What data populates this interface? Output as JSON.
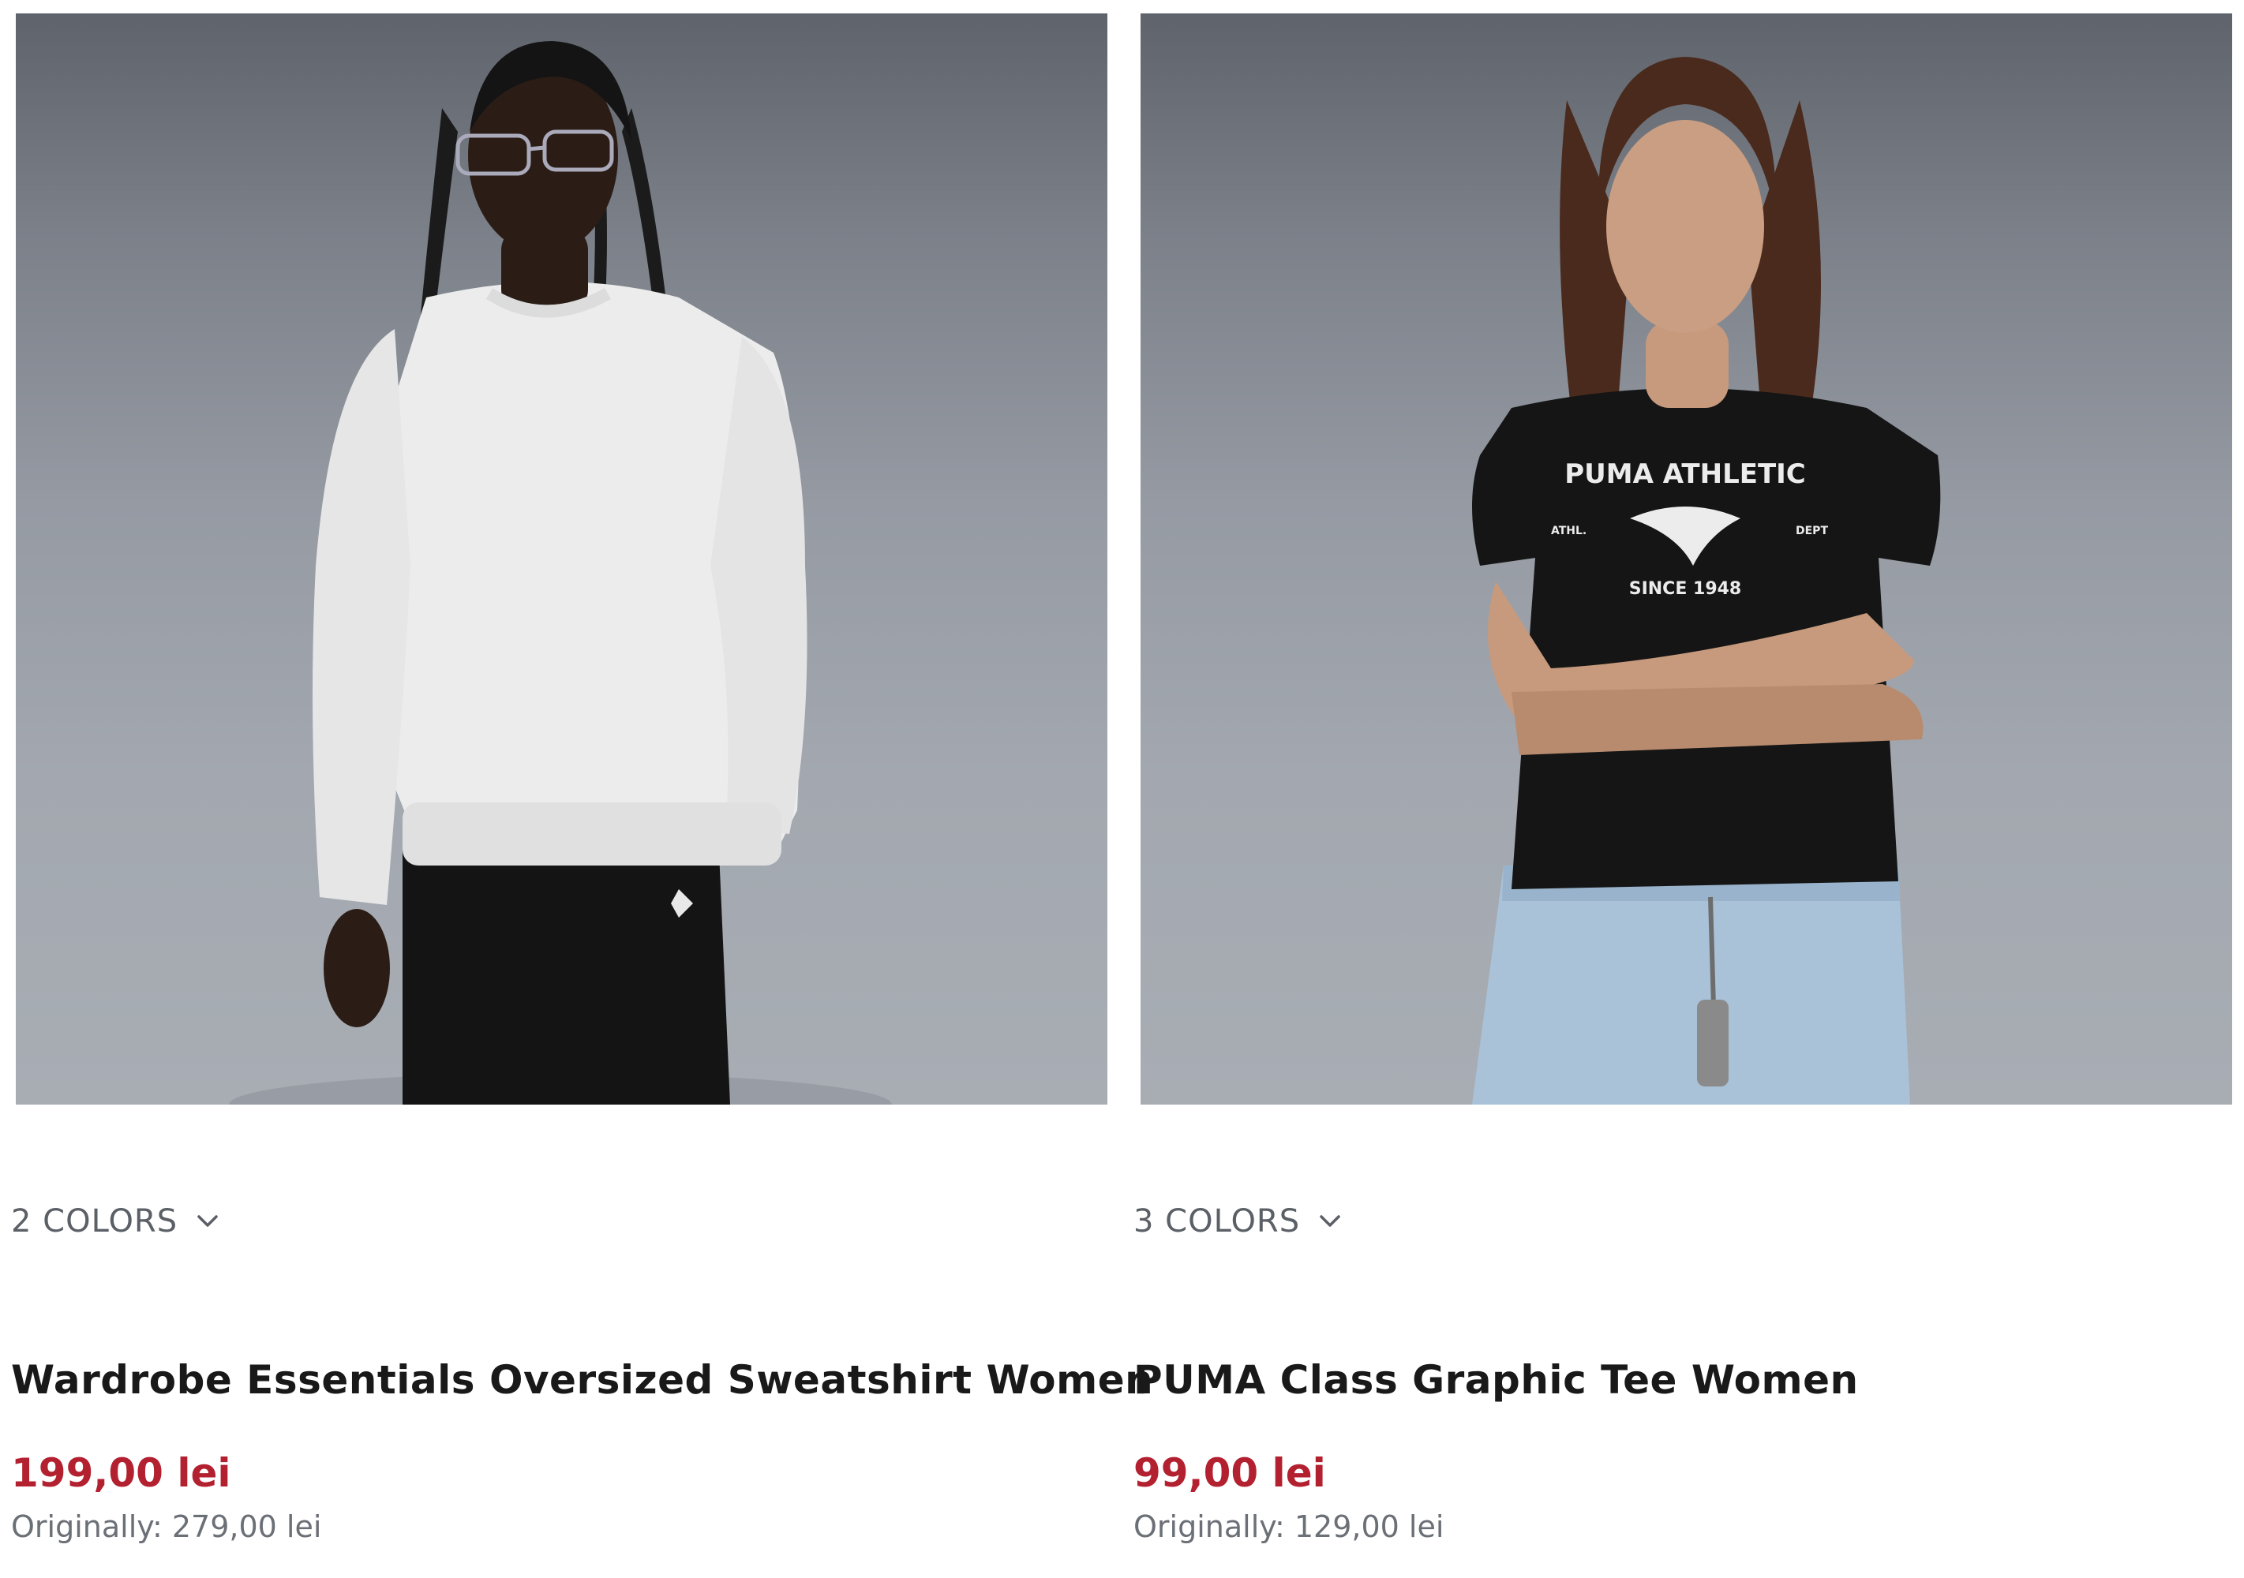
{
  "products": [
    {
      "colors_label": "2 COLORS",
      "name": "Wardrobe Essentials Oversized Sweatshirt Women",
      "sale_price": "199,00 lei",
      "original_price": "Originally: 279,00 lei",
      "image_subject": "woman in white oversized sweatshirt and black pants",
      "colors_icon": "chevron-down-icon"
    },
    {
      "colors_label": "3 COLORS",
      "name": "PUMA Class Graphic Tee Women",
      "sale_price": "99,00 lei",
      "original_price": "Originally: 129,00 lei",
      "image_subject": "woman in black PUMA graphic tee and light blue jeans",
      "colors_icon": "chevron-down-icon",
      "graphic_text": {
        "line1": "PUMA ATHLETIC",
        "left": "ATHL.",
        "right": "DEPT",
        "line2": "SINCE 1948"
      }
    }
  ],
  "colors": {
    "sale_red": "#b3202f",
    "text_dark": "#191919",
    "text_muted": "#6b6f76",
    "image_bg": "#9aa0a8"
  }
}
